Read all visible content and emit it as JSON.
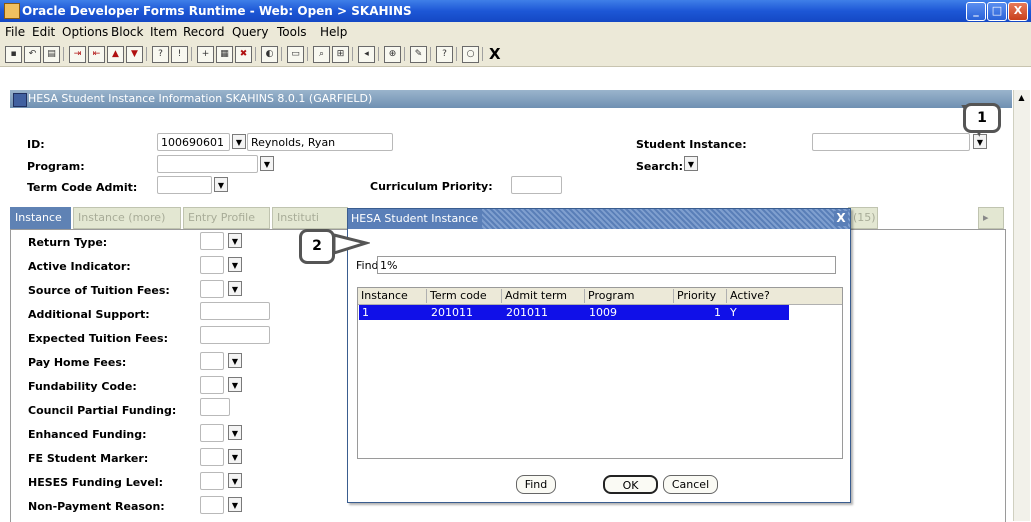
{
  "window": {
    "title": "Oracle Developer Forms Runtime - Web:  Open > SKAHINS",
    "controls": [
      "_",
      "□",
      "X"
    ]
  },
  "menu": [
    "File",
    "Edit",
    "Options",
    "Block",
    "Item",
    "Record",
    "Query",
    "Tools",
    "Help"
  ],
  "toolbar": {
    "exit_label": "X"
  },
  "form": {
    "header": "HESA Student Instance Information  SKAHINS 8.0.1  (GARFIELD)",
    "id_label": "ID:",
    "id_value": "100690601",
    "name_value": "Reynolds, Ryan",
    "program_label": "Program:",
    "term_label": "Term Code Admit:",
    "curriculum_label": "Curriculum Priority:",
    "student_instance_label": "Student Instance:",
    "search_label": "Search:"
  },
  "tabs": [
    "Instance",
    "Instance (more)",
    "Entry Profile",
    "Instituti",
    "(15)"
  ],
  "left_fields": [
    {
      "label": "Return Type:",
      "dropdown": true
    },
    {
      "label": "Active Indicator:",
      "dropdown": true
    },
    {
      "label": "Source of Tuition Fees:",
      "dropdown": true
    },
    {
      "label": "Additional Support:",
      "dropdown": false
    },
    {
      "label": "Expected Tuition Fees:",
      "dropdown": false
    },
    {
      "label": "Pay Home Fees:",
      "dropdown": true
    },
    {
      "label": "Fundability Code:",
      "dropdown": true
    },
    {
      "label": "Council Partial Funding:",
      "dropdown": false
    },
    {
      "label": "Enhanced Funding:",
      "dropdown": true
    },
    {
      "label": "FE Student Marker:",
      "dropdown": true
    },
    {
      "label": "HESES Funding Level:",
      "dropdown": true
    },
    {
      "label": "Non-Payment Reason:",
      "dropdown": true
    }
  ],
  "dialog": {
    "title": "HESA Student Instance",
    "find_label": "Find",
    "find_value": "1%",
    "columns": [
      "Instance",
      "Term code",
      "Admit term",
      "Program",
      "Priority",
      "Active?"
    ],
    "rows": [
      {
        "instance": "1",
        "term_code": "201011",
        "admit_term": "201011",
        "program": "1009",
        "priority": "1",
        "active": "Y"
      }
    ],
    "find_button": "Find",
    "ok_button": "OK",
    "cancel_button": "Cancel",
    "close_label": "X"
  },
  "callouts": {
    "one": "1",
    "two": "2"
  },
  "colors": {
    "titlebar": "#1d57d6",
    "selection": "#1010e8",
    "tab_active": "#5f82b4"
  }
}
